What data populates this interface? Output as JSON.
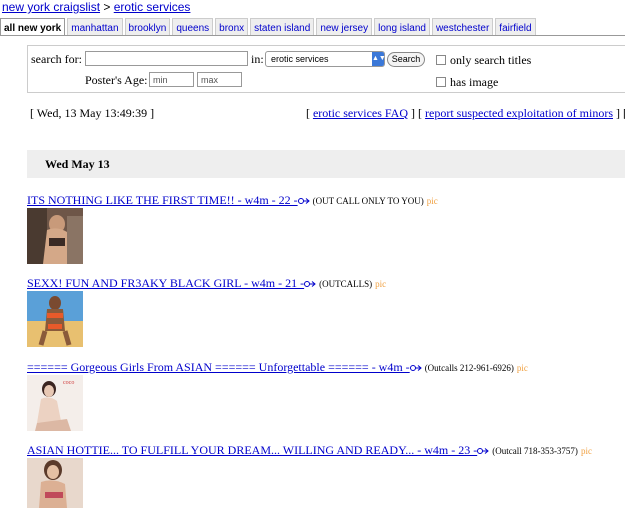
{
  "breadcrumb": {
    "site": "new york craigslist",
    "sep": ">",
    "section": "erotic services"
  },
  "tabs": [
    "all new york",
    "manhattan",
    "brooklyn",
    "queens",
    "bronx",
    "staten island",
    "new jersey",
    "long island",
    "westchester",
    "fairfield"
  ],
  "selected_tab": "all new york",
  "search": {
    "search_for_label": "search for:",
    "query_value": "",
    "in_label": "in:",
    "category_value": "erotic services",
    "search_button": "Search",
    "only_titles_label": "only search titles",
    "has_image_label": "has image",
    "age_label": "Poster's Age:",
    "age_min_placeholder": "min",
    "age_max_placeholder": "max"
  },
  "timestamp": "[ Wed, 13 May 13:49:39 ]",
  "top_links": {
    "open1": "[ ",
    "faq": "erotic services FAQ",
    "mid": " ] [ ",
    "report": "report suspected exploitation of minors",
    "close": " ] ["
  },
  "day_header": "Wed May 13",
  "posts": [
    {
      "title": "ITS NOTHING LIKE THE FIRST TIME!! - w4m - 22 -",
      "location": "(OUT CALL ONLY TO YOU)",
      "pic": "pic"
    },
    {
      "title": "SEXX! FUN AND FR3AKY BLACK GIRL - w4m - 21 -",
      "location": "(OUTCALLS)",
      "pic": "pic"
    },
    {
      "title": "====== Gorgeous Girls From ASIAN ====== Unforgettable ====== - w4m -",
      "location": "(Outcalls 212-961-6926)",
      "pic": "pic",
      "thumb_text": "coco"
    },
    {
      "title": "ASIAN HOTTIE... TO FULFILL YOUR DREAM... WILLING AND READY... - w4m - 23 -",
      "location": "(Outcall 718-353-3757)",
      "pic": "pic"
    }
  ],
  "colors": {
    "link": "#0000cc",
    "pic": "#f0a040",
    "day_header_bg": "#eeeeee",
    "select_arrow": "#3b78d8"
  }
}
